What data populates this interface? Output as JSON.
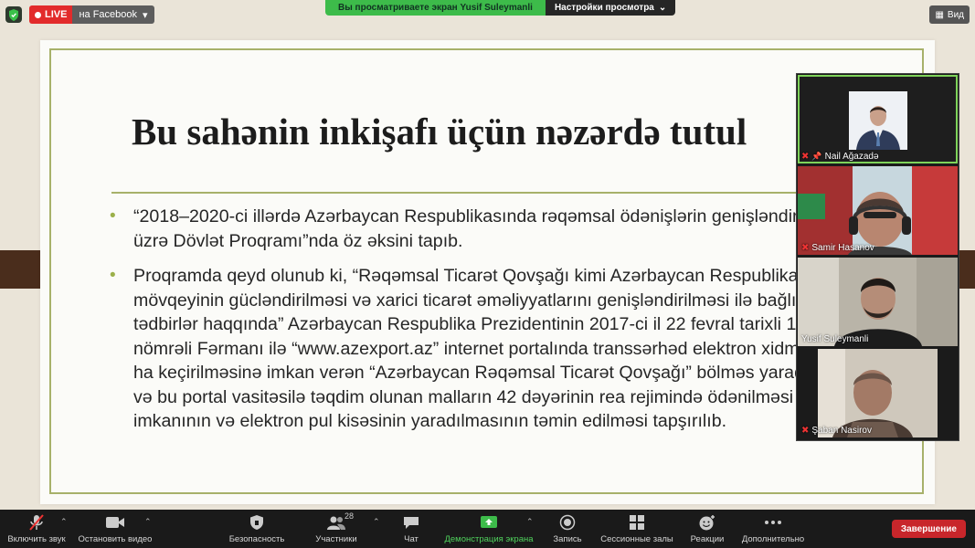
{
  "top": {
    "live_label": "LIVE",
    "live_destination": "на Facebook",
    "share_message": "Вы просматриваете экран Yusif Suleymanli",
    "view_options": "Настройки просмотра",
    "view_button": "Вид"
  },
  "slide": {
    "title": "Bu sahənin inkişafı üçün nəzərdə tutul",
    "bullets": [
      "“2018–2020-ci illərdə Azərbaycan Respublikasında rəqəmsal ödənişlərin genişləndirilməsi üzrə Dövlət Proqramı”nda öz əksini tapıb.",
      "Proqramda qeyd olunub ki, “Rəqəmsal Ticarət Qovşağı kimi Azərbaycan Respublikasının mövqeyinin gücləndirilməsi və xarici ticarət əməliyyatlarını genişləndirilməsi ilə bağlı əlavə tədbirlər haqqında” Azərbaycan Respublika Prezidentinin 2017-ci il 22 fevral tarixli 1255 nömrəli Fərmanı ilə “www.azexport.az” internet portalında transsərhəd elektron xidmətlərin ha keçirilməsinə imkan verən “Azərbaycan Rəqəmsal Ticarət Qovşağı” bölməs yaradılması və bu portal vasitəsilə təqdim olunan malların 42 dəyərinin rea rejimində ödənilməsi imkanının və elektron pul kisəsinin yaradılmasının təmin edilməsi tapşırılıb."
    ],
    "accent_color": "#a7b16a"
  },
  "participants": [
    {
      "name": "Nail Ağazadə",
      "muted": true,
      "pinned": true
    },
    {
      "name": "Samir Hasanov",
      "muted": true,
      "pinned": false
    },
    {
      "name": "Yusif Suleymanli",
      "muted": false,
      "pinned": false
    },
    {
      "name": "Şaban Nasirov",
      "muted": true,
      "pinned": false
    }
  ],
  "toolbar": {
    "mute": "Включить звук",
    "video": "Остановить видео",
    "security": "Безопасность",
    "participants": "Участники",
    "participants_count": "28",
    "chat": "Чат",
    "share": "Демонстрация экрана",
    "record": "Запись",
    "breakout": "Сессионные залы",
    "reactions": "Реакции",
    "more": "Дополнительно",
    "end": "Завершение"
  },
  "colors": {
    "live": "#e22b2b",
    "share_banner": "#3dbb4a",
    "end_button": "#c8262b",
    "active_speaker": "#7fd35a"
  }
}
